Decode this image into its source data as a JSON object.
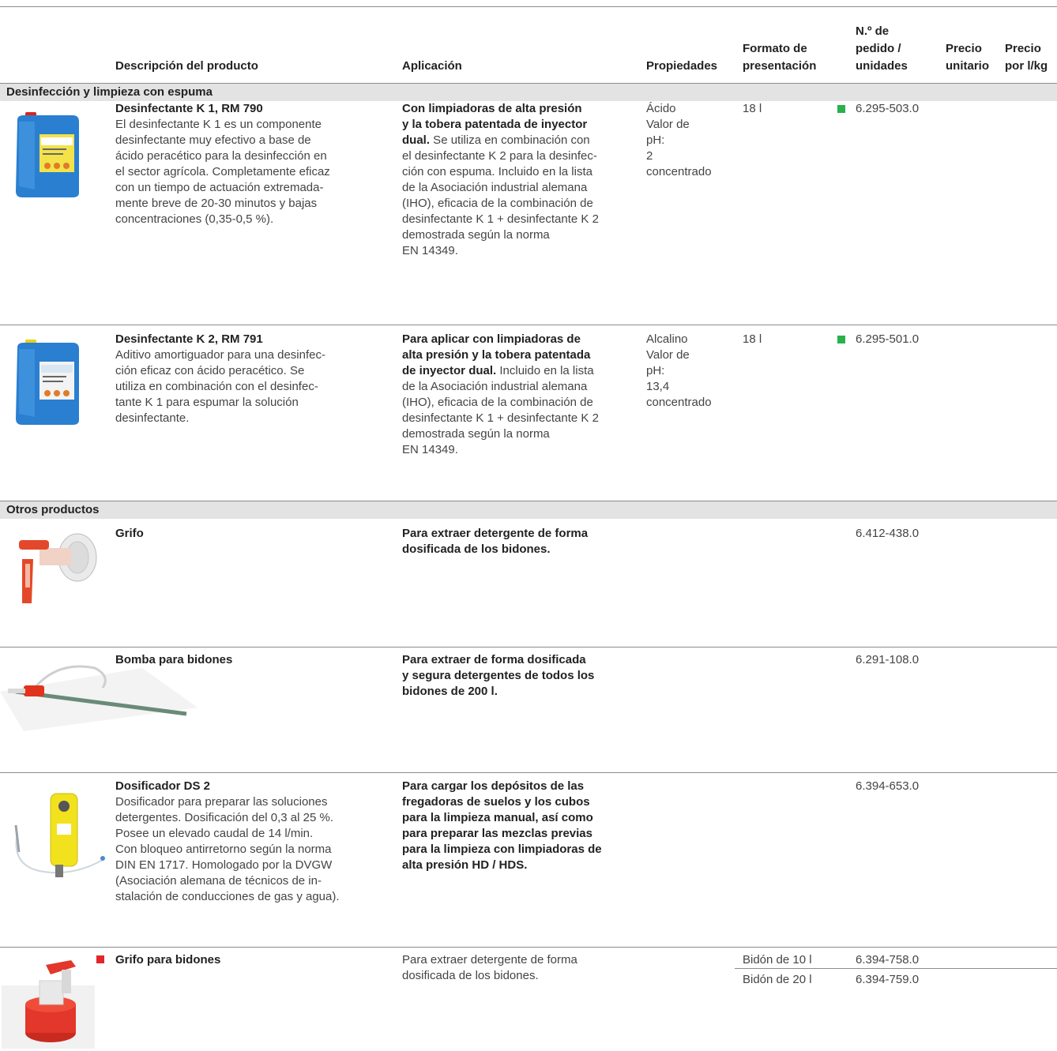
{
  "header": {
    "descripcion": "Descripción del producto",
    "aplicacion": "Aplicación",
    "propiedades": "Propiedades",
    "formato_l1": "Formato de",
    "formato_l2": "presentación",
    "pedido_l1": "N.º de",
    "pedido_l2": "pedido /",
    "pedido_l3": "unidades",
    "precio_unit_l1": "Precio",
    "precio_unit_l2": "unitario",
    "precio_lkg_l1": "Precio",
    "precio_lkg_l2": "por l/kg"
  },
  "sections": [
    {
      "title": "Desinfección y limpieza con espuma"
    },
    {
      "title": "Otros productos"
    }
  ],
  "products": [
    {
      "name": "Desinfectante K 1, RM 790",
      "desc": [
        "El desinfectante K 1 es un componente",
        "desinfectante muy efectivo a base de",
        "ácido peracético para la desinfección en",
        "el sector agrícola. Completamente eficaz",
        "con un tiempo de actuación extremada-",
        "mente breve de 20-30 minutos y bajas",
        "concentraciones (0,35-0,5 %)."
      ],
      "app_bold": [
        "Con limpiadoras de alta presión",
        "y la tobera patentada de inyector",
        "dual."
      ],
      "app_rest": [
        " Se utiliza en combinación con",
        "el desinfectante K 2 para la desinfec-",
        "ción con espuma. Incluido en la lista",
        "de la Asociación industrial alemana",
        "(IHO), eficacia de la combinación de",
        "desinfectante K 1 + desinfectante K 2",
        "demostrada según la norma",
        "EN 14349."
      ],
      "props": [
        "Ácido",
        "Valor de",
        "pH:",
        "2",
        "concentrado"
      ],
      "formato": "18 l",
      "pedido": "6.295-503.0",
      "image": "blue-canister-red-cap"
    },
    {
      "name": "Desinfectante K 2, RM 791",
      "desc": [
        "Aditivo amortiguador para una desinfec-",
        "ción eficaz con ácido peracético. Se",
        "utiliza en combinación con el desinfec-",
        "tante K 1 para espumar la solución",
        "desinfectante."
      ],
      "app_bold": [
        "Para aplicar con limpiadoras de",
        "alta presión y la tobera patentada",
        "de inyector dual."
      ],
      "app_rest": [
        " Incluido en la lista",
        "de la Asociación industrial alemana",
        "(IHO), eficacia de la combinación de",
        "desinfectante K 1 + desinfectante K 2",
        "demostrada según la norma",
        "EN 14349."
      ],
      "props": [
        "Alcalino",
        "Valor de",
        "pH:",
        "13,4",
        "concentrado"
      ],
      "formato": "18 l",
      "pedido": "6.295-501.0",
      "image": "blue-canister-yellow-cap"
    },
    {
      "name": "Grifo",
      "app": [
        "Para extraer detergente de forma",
        "dosificada de los bidones."
      ],
      "pedido": "6.412-438.0",
      "image": "tap"
    },
    {
      "name": "Bomba para bidones",
      "app": [
        "Para extraer de forma dosificada",
        "y segura detergentes de todos los",
        "bidones de 200 l."
      ],
      "pedido": "6.291-108.0",
      "image": "drum-pump"
    },
    {
      "name": "Dosificador DS 2",
      "desc": [
        "Dosificador para preparar las soluciones",
        "detergentes. Dosificación del 0,3 al 25 %.",
        "Posee un elevado caudal de 14 l/min.",
        "Con bloqueo antirretorno según la norma",
        "DIN EN 1717. Homologado por la DVGW",
        "(Asociación alemana de técnicos de in-",
        "stalación de conducciones de gas y agua)."
      ],
      "app": [
        "Para cargar los depósitos de las",
        "fregadoras de suelos y los cubos",
        "para la limpieza manual, así como",
        "para preparar las mezclas previas",
        "para la limpieza con limpiadoras de",
        "alta presión HD / HDS."
      ],
      "pedido": "6.394-653.0",
      "image": "dosing-unit"
    },
    {
      "name": "Grifo para bidones",
      "app": [
        "Para extraer detergente de forma",
        "dosificada de los bidones."
      ],
      "variants": [
        {
          "formato": "Bidón de 10 l",
          "pedido": "6.394-758.0"
        },
        {
          "formato": "Bidón de 20 l",
          "pedido": "6.394-759.0"
        }
      ],
      "image": "canister-tap"
    }
  ],
  "colors": {
    "new_marker": "#29b14a",
    "red_marker": "#e3262c",
    "section_bg": "#e3e3e3"
  }
}
